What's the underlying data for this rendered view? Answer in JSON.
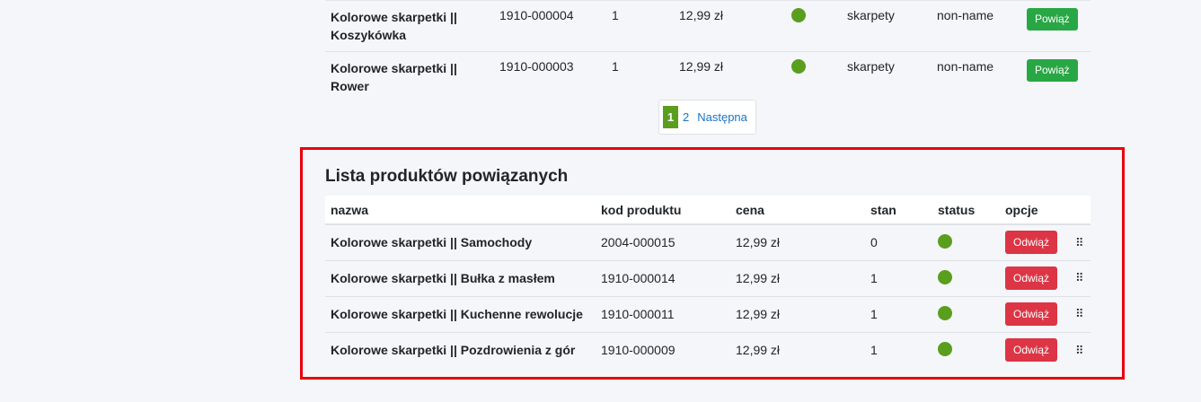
{
  "top_rows": [
    {
      "name_line1": "Kolorowe skarpetki ||",
      "name_line2": "Koszykówka",
      "code": "1910-000004",
      "qty": "1",
      "price": "12,99 zł",
      "category": "skarpety",
      "brand": "non-name",
      "action": "Powiąż"
    },
    {
      "name_line1": "Kolorowe skarpetki || Rower",
      "name_line2": "",
      "code": "1910-000003",
      "qty": "1",
      "price": "12,99 zł",
      "category": "skarpety",
      "brand": "non-name",
      "action": "Powiąż"
    }
  ],
  "pagination": {
    "current": "1",
    "page2": "2",
    "next": "Następna"
  },
  "related": {
    "title": "Lista produktów powiązanych",
    "headers": {
      "name": "nazwa",
      "code": "kod produktu",
      "price": "cena",
      "stock": "stan",
      "status": "status",
      "options": "opcje"
    },
    "rows": [
      {
        "name": "Kolorowe skarpetki || Samochody",
        "code": "2004-000015",
        "price": "12,99 zł",
        "stock": "0",
        "action": "Odwiąż"
      },
      {
        "name": "Kolorowe skarpetki || Bułka z masłem",
        "code": "1910-000014",
        "price": "12,99 zł",
        "stock": "1",
        "action": "Odwiąż"
      },
      {
        "name": "Kolorowe skarpetki || Kuchenne rewolucje",
        "code": "1910-000011",
        "price": "12,99 zł",
        "stock": "1",
        "action": "Odwiąż"
      },
      {
        "name": "Kolorowe skarpetki || Pozdrowienia z gór",
        "code": "1910-000009",
        "price": "12,99 zł",
        "stock": "1",
        "action": "Odwiąż"
      }
    ]
  },
  "colors": {
    "status_active": "#5a9e1d",
    "bind_button": "#28a745",
    "unbind_button": "#dc3545",
    "highlight_border": "#e8000c"
  },
  "icons": {
    "status": "status-dot-icon",
    "drag": "drag-handle-icon"
  }
}
